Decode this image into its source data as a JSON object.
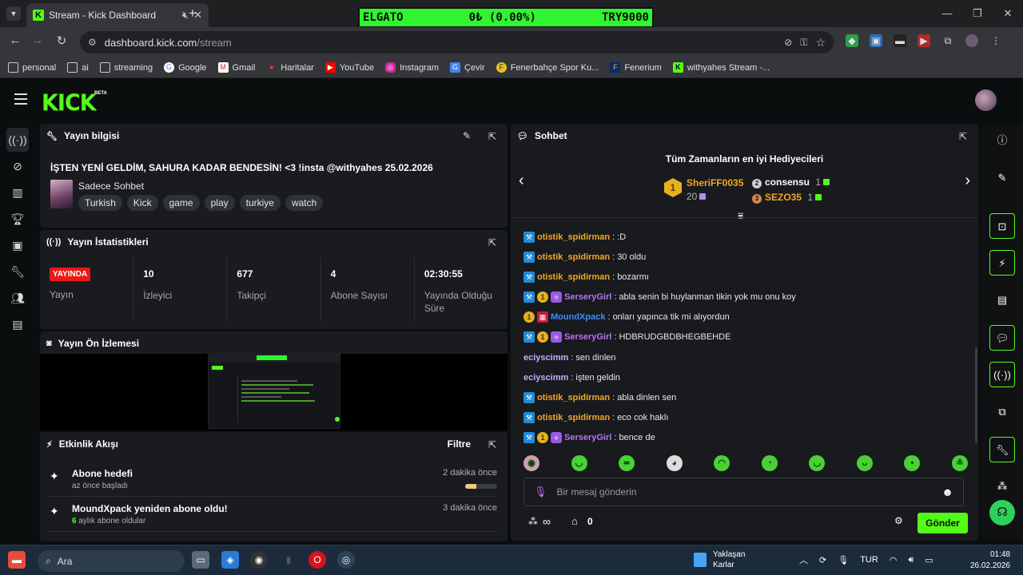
{
  "browser": {
    "tab_title": "Stream - Kick Dashboard",
    "url_host": "dashboard.kick.com",
    "url_path": "/stream",
    "bookmarks": [
      "personal",
      "ai",
      "streaming",
      "Google",
      "Gmail",
      "Haritalar",
      "YouTube",
      "Instagram",
      "Çevir",
      "Fenerbahçe Spor Ku...",
      "Fenerium",
      "withyahes Stream -..."
    ]
  },
  "ticker": {
    "name": "ELGATO",
    "change": "0₺ (0.00%)",
    "code": "TRY9000"
  },
  "brand": {
    "logo": "KICK",
    "beta": "BETA",
    "accent": "#53fc18"
  },
  "info_panel": {
    "title": "Yayın bilgisi",
    "stream_title": "İŞTEN YENİ GELDİM, SAHURA KADAR BENDESİN! <3 !insta @withyahes 25.02.2026",
    "category": "Sadece Sohbet",
    "tags": [
      "Turkish",
      "Kick",
      "game",
      "play",
      "turkiye",
      "watch"
    ]
  },
  "stats_panel": {
    "title": "Yayın İstatistikleri",
    "live_label": "YAYINDA",
    "stream_label": "Yayın",
    "items": [
      {
        "value": "10",
        "label": "İzleyici"
      },
      {
        "value": "677",
        "label": "Takipçi"
      },
      {
        "value": "4",
        "label": "Abone Sayısı"
      },
      {
        "value": "02:30:55",
        "label": "Yayında Olduğu Süre"
      }
    ]
  },
  "preview_panel": {
    "title": "Yayın Ön İzlemesi"
  },
  "activity_panel": {
    "title": "Etkinlik Akışı",
    "filter": "Filtre",
    "items": [
      {
        "title": "Abone hedefi",
        "sub": "az önce başladı",
        "time": "2 dakika önce",
        "progress": 0.35
      },
      {
        "title": "MoundXpack yeniden abone oldu!",
        "sub_count": "6",
        "sub_rest": " aylık abone oldular",
        "time": "3 dakika önce"
      }
    ]
  },
  "chat": {
    "title": "Sohbet",
    "gifters_title": "Tüm Zamanların en iyi Hediyecileri",
    "gifters": [
      {
        "rank": "1",
        "name": "SheriFF0035",
        "count": "20"
      },
      {
        "rank": "2",
        "name": "consensu",
        "count": "1"
      },
      {
        "rank": "3",
        "name": "SEZO35",
        "count": "1"
      }
    ],
    "messages": [
      {
        "user": "otistik_spidirman",
        "text": ": :D",
        "color": "#f5a623",
        "badges": [
          "mod"
        ]
      },
      {
        "user": "otistik_spidirman",
        "text": ": 30 oldu",
        "color": "#f5a623",
        "badges": [
          "mod"
        ]
      },
      {
        "user": "otistik_spidirman",
        "text": ": bozarmı",
        "color": "#f5a623",
        "badges": [
          "mod"
        ]
      },
      {
        "user": "SerseryGirl",
        "text": ": abla senin bi huylanman tikin yok mu onu koy",
        "color": "#b873f0",
        "badges": [
          "mod",
          "sub",
          "vip"
        ]
      },
      {
        "user": "MoundXpack",
        "text": ": onları yapınca tik mi alıyordun",
        "color": "#3a8df7",
        "badges": [
          "sub",
          "red"
        ]
      },
      {
        "user": "SerseryGirl",
        "text": ": HDBRUDGBDBHEGBEHDE",
        "color": "#b873f0",
        "badges": [
          "mod",
          "sub",
          "vip"
        ]
      },
      {
        "user": "eciyscimm",
        "text": ": sen dinlen",
        "color": "#d0a8f8",
        "badges": []
      },
      {
        "user": "eciyscimm",
        "text": ": işten geldin",
        "color": "#d0a8f8",
        "badges": []
      },
      {
        "user": "otistik_spidirman",
        "text": ": abla dinlen sen",
        "color": "#f5a623",
        "badges": [
          "mod"
        ]
      },
      {
        "user": "otistik_spidirman",
        "text": ": eco cok haklı",
        "color": "#f5a623",
        "badges": [
          "mod"
        ]
      },
      {
        "user": "SerseryGirl",
        "text": ": bence de",
        "color": "#b873f0",
        "badges": [
          "mod",
          "sub",
          "vip"
        ]
      }
    ],
    "input_placeholder": "Bir mesaj gönderin",
    "infinity": "∞",
    "store_count": "0",
    "send_label": "Gönder"
  },
  "taskbar": {
    "search": "Ara",
    "weather_line1": "Yaklaşan",
    "weather_line2": "Karlar",
    "lang": "TUR",
    "time": "01:48",
    "date": "26.02.2026"
  }
}
